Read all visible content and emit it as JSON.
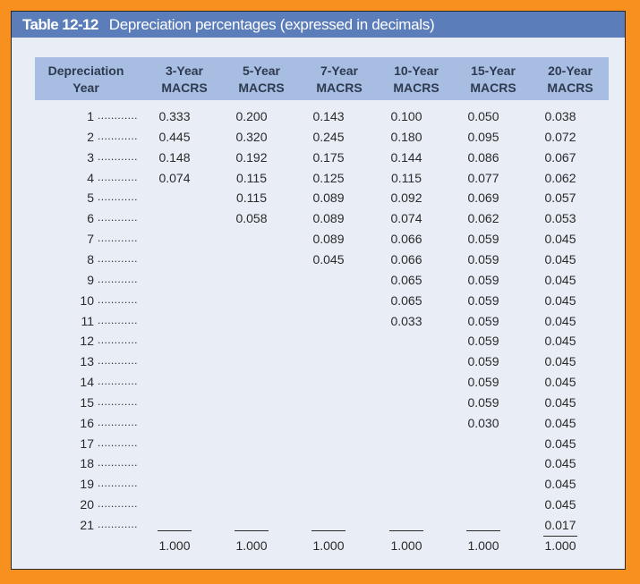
{
  "title": {
    "number": "Table 12-12",
    "text": "Depreciation percentages (expressed in decimals)"
  },
  "headers": [
    {
      "line1": "Depreciation",
      "line2": "Year"
    },
    {
      "line1": "3-Year",
      "line2": "MACRS"
    },
    {
      "line1": "5-Year",
      "line2": "MACRS"
    },
    {
      "line1": "7-Year",
      "line2": "MACRS"
    },
    {
      "line1": "10-Year",
      "line2": "MACRS"
    },
    {
      "line1": "15-Year",
      "line2": "MACRS"
    },
    {
      "line1": "20-Year",
      "line2": "MACRS"
    }
  ],
  "leader_dots": "............",
  "rows": [
    {
      "year": "1",
      "values": [
        "0.333",
        "0.200",
        "0.143",
        "0.100",
        "0.050",
        "0.038"
      ]
    },
    {
      "year": "2",
      "values": [
        "0.445",
        "0.320",
        "0.245",
        "0.180",
        "0.095",
        "0.072"
      ]
    },
    {
      "year": "3",
      "values": [
        "0.148",
        "0.192",
        "0.175",
        "0.144",
        "0.086",
        "0.067"
      ]
    },
    {
      "year": "4",
      "values": [
        "0.074",
        "0.115",
        "0.125",
        "0.115",
        "0.077",
        "0.062"
      ]
    },
    {
      "year": "5",
      "values": [
        "",
        "0.115",
        "0.089",
        "0.092",
        "0.069",
        "0.057"
      ]
    },
    {
      "year": "6",
      "values": [
        "",
        "0.058",
        "0.089",
        "0.074",
        "0.062",
        "0.053"
      ]
    },
    {
      "year": "7",
      "values": [
        "",
        "",
        "0.089",
        "0.066",
        "0.059",
        "0.045"
      ]
    },
    {
      "year": "8",
      "values": [
        "",
        "",
        "0.045",
        "0.066",
        "0.059",
        "0.045"
      ]
    },
    {
      "year": "9",
      "values": [
        "",
        "",
        "",
        "0.065",
        "0.059",
        "0.045"
      ]
    },
    {
      "year": "10",
      "values": [
        "",
        "",
        "",
        "0.065",
        "0.059",
        "0.045"
      ]
    },
    {
      "year": "11",
      "values": [
        "",
        "",
        "",
        "0.033",
        "0.059",
        "0.045"
      ]
    },
    {
      "year": "12",
      "values": [
        "",
        "",
        "",
        "",
        "0.059",
        "0.045"
      ]
    },
    {
      "year": "13",
      "values": [
        "",
        "",
        "",
        "",
        "0.059",
        "0.045"
      ]
    },
    {
      "year": "14",
      "values": [
        "",
        "",
        "",
        "",
        "0.059",
        "0.045"
      ]
    },
    {
      "year": "15",
      "values": [
        "",
        "",
        "",
        "",
        "0.059",
        "0.045"
      ]
    },
    {
      "year": "16",
      "values": [
        "",
        "",
        "",
        "",
        "0.030",
        "0.045"
      ]
    },
    {
      "year": "17",
      "values": [
        "",
        "",
        "",
        "",
        "",
        "0.045"
      ]
    },
    {
      "year": "18",
      "values": [
        "",
        "",
        "",
        "",
        "",
        "0.045"
      ]
    },
    {
      "year": "19",
      "values": [
        "",
        "",
        "",
        "",
        "",
        "0.045"
      ]
    },
    {
      "year": "20",
      "values": [
        "",
        "",
        "",
        "",
        "",
        "0.045"
      ]
    },
    {
      "year": "21",
      "values": [
        "",
        "",
        "",
        "",
        "",
        "0.017"
      ]
    }
  ],
  "totals": [
    "1.000",
    "1.000",
    "1.000",
    "1.000",
    "1.000",
    "1.000"
  ],
  "colors": {
    "frame": "#f7901e",
    "title_bar": "#5b7dba",
    "header_band": "#a8bde2",
    "panel": "#e8edf6"
  }
}
